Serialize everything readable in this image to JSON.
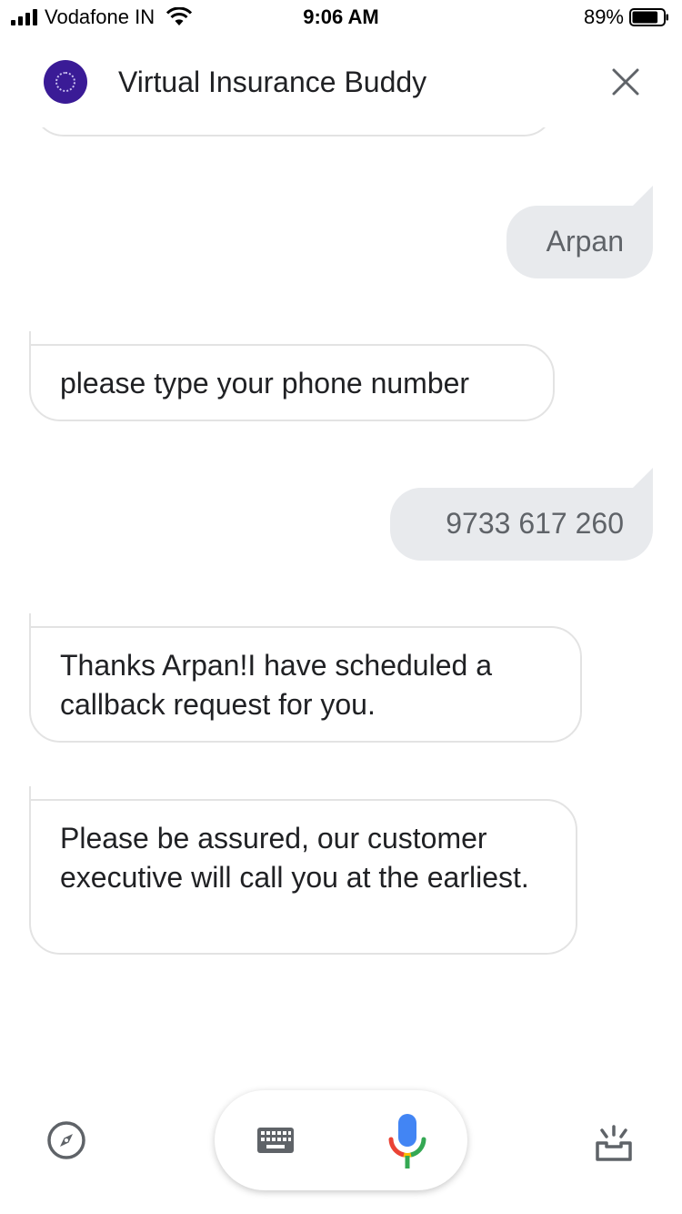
{
  "status_bar": {
    "carrier": "Vodafone IN",
    "time": "9:06 AM",
    "battery": "89%",
    "battery_level": 0.89
  },
  "header": {
    "title": "Virtual Insurance Buddy"
  },
  "messages": [
    {
      "sender": "user",
      "text": "Arpan"
    },
    {
      "sender": "bot",
      "text": "please type your phone number"
    },
    {
      "sender": "user",
      "text": "9733 617 260"
    },
    {
      "sender": "bot",
      "text": "Thanks Arpan!I have scheduled a callback request for you."
    },
    {
      "sender": "bot",
      "text": "Please be assured, our customer executive will call you at the earliest."
    }
  ],
  "bottom_bar": {
    "icons": [
      "explore-icon",
      "keyboard-icon",
      "microphone-icon",
      "inbox-icon"
    ]
  },
  "colors": {
    "avatar": "#3a1b96",
    "user_bubble": "#e8eaed",
    "mic_blue": "#4285f4",
    "mic_red": "#ea4335",
    "mic_yellow": "#fbbc05",
    "mic_green": "#34a853"
  }
}
